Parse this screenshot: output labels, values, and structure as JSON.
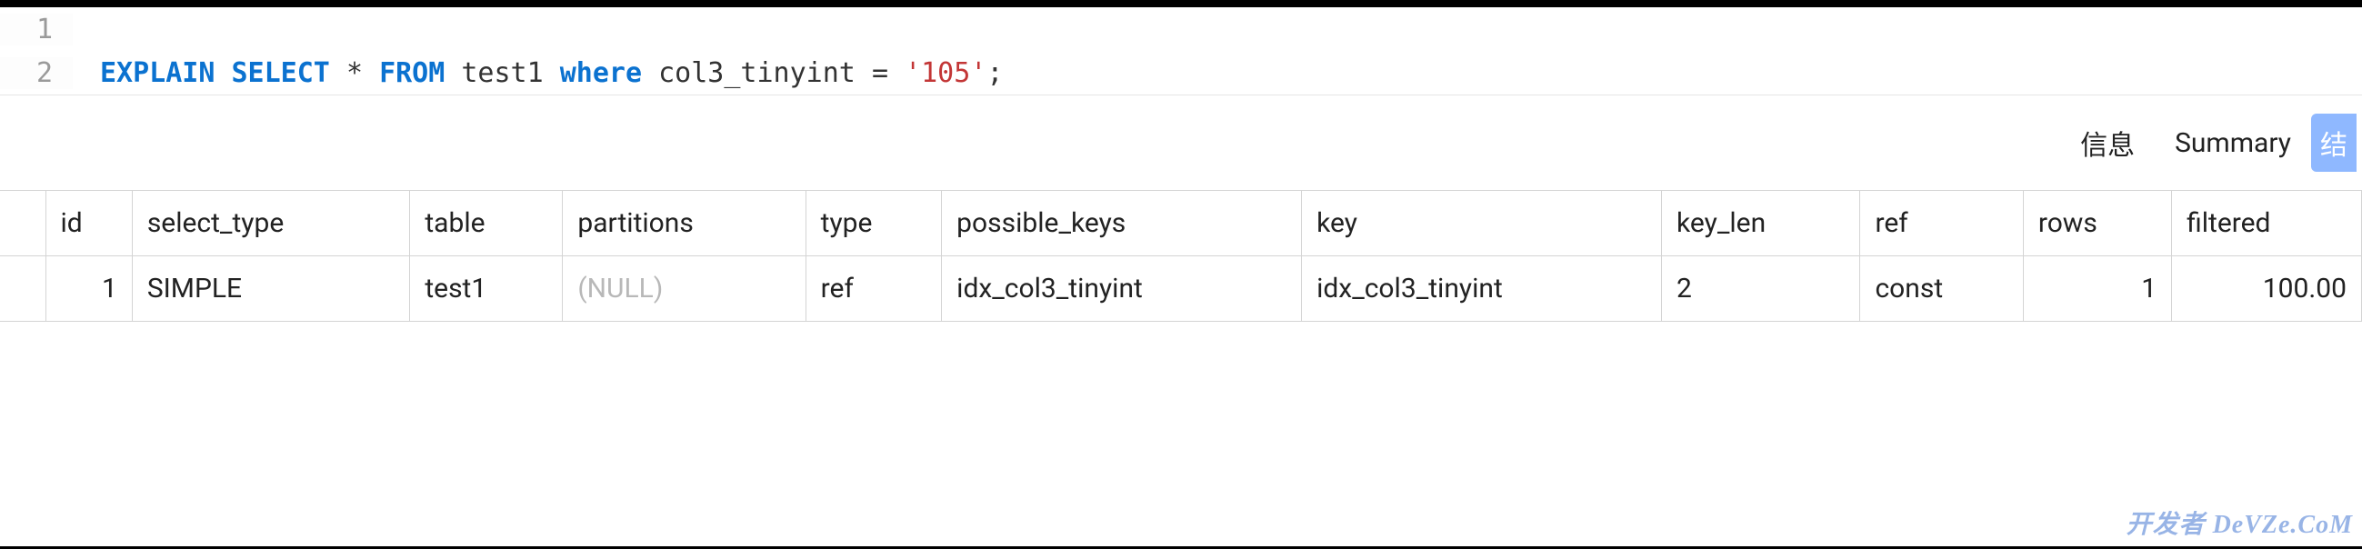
{
  "editor": {
    "lines": [
      {
        "num": "1",
        "tokens": []
      },
      {
        "num": "2",
        "tokens": [
          {
            "t": "EXPLAIN",
            "cls": "kw-blue"
          },
          {
            "t": " ",
            "cls": ""
          },
          {
            "t": "SELECT",
            "cls": "kw-blue"
          },
          {
            "t": " ",
            "cls": ""
          },
          {
            "t": "*",
            "cls": "op"
          },
          {
            "t": " ",
            "cls": ""
          },
          {
            "t": "FROM",
            "cls": "kw-blue"
          },
          {
            "t": " ",
            "cls": ""
          },
          {
            "t": "test1",
            "cls": "ident"
          },
          {
            "t": " ",
            "cls": ""
          },
          {
            "t": "where",
            "cls": "kw-blue"
          },
          {
            "t": " ",
            "cls": ""
          },
          {
            "t": "col3_tinyint",
            "cls": "ident"
          },
          {
            "t": " ",
            "cls": ""
          },
          {
            "t": "=",
            "cls": "op"
          },
          {
            "t": " ",
            "cls": ""
          },
          {
            "t": "'105'",
            "cls": "str"
          },
          {
            "t": ";",
            "cls": "op"
          }
        ]
      }
    ]
  },
  "tabs": {
    "info": "信息",
    "summary": "Summary",
    "result": "结"
  },
  "table": {
    "headers": [
      "",
      "id",
      "select_type",
      "table",
      "partitions",
      "type",
      "possible_keys",
      "key",
      "key_len",
      "ref",
      "rows",
      "filtered"
    ],
    "rows": [
      {
        "blank": "",
        "id": "1",
        "select_type": "SIMPLE",
        "table": "test1",
        "partitions": "(NULL)",
        "type": "ref",
        "possible_keys": "idx_col3_tinyint",
        "key": "idx_col3_tinyint",
        "key_len": "2",
        "ref": "const",
        "rows": "1",
        "filtered": "100.00"
      }
    ]
  },
  "watermark": "开发者  DeVZe.CoM"
}
